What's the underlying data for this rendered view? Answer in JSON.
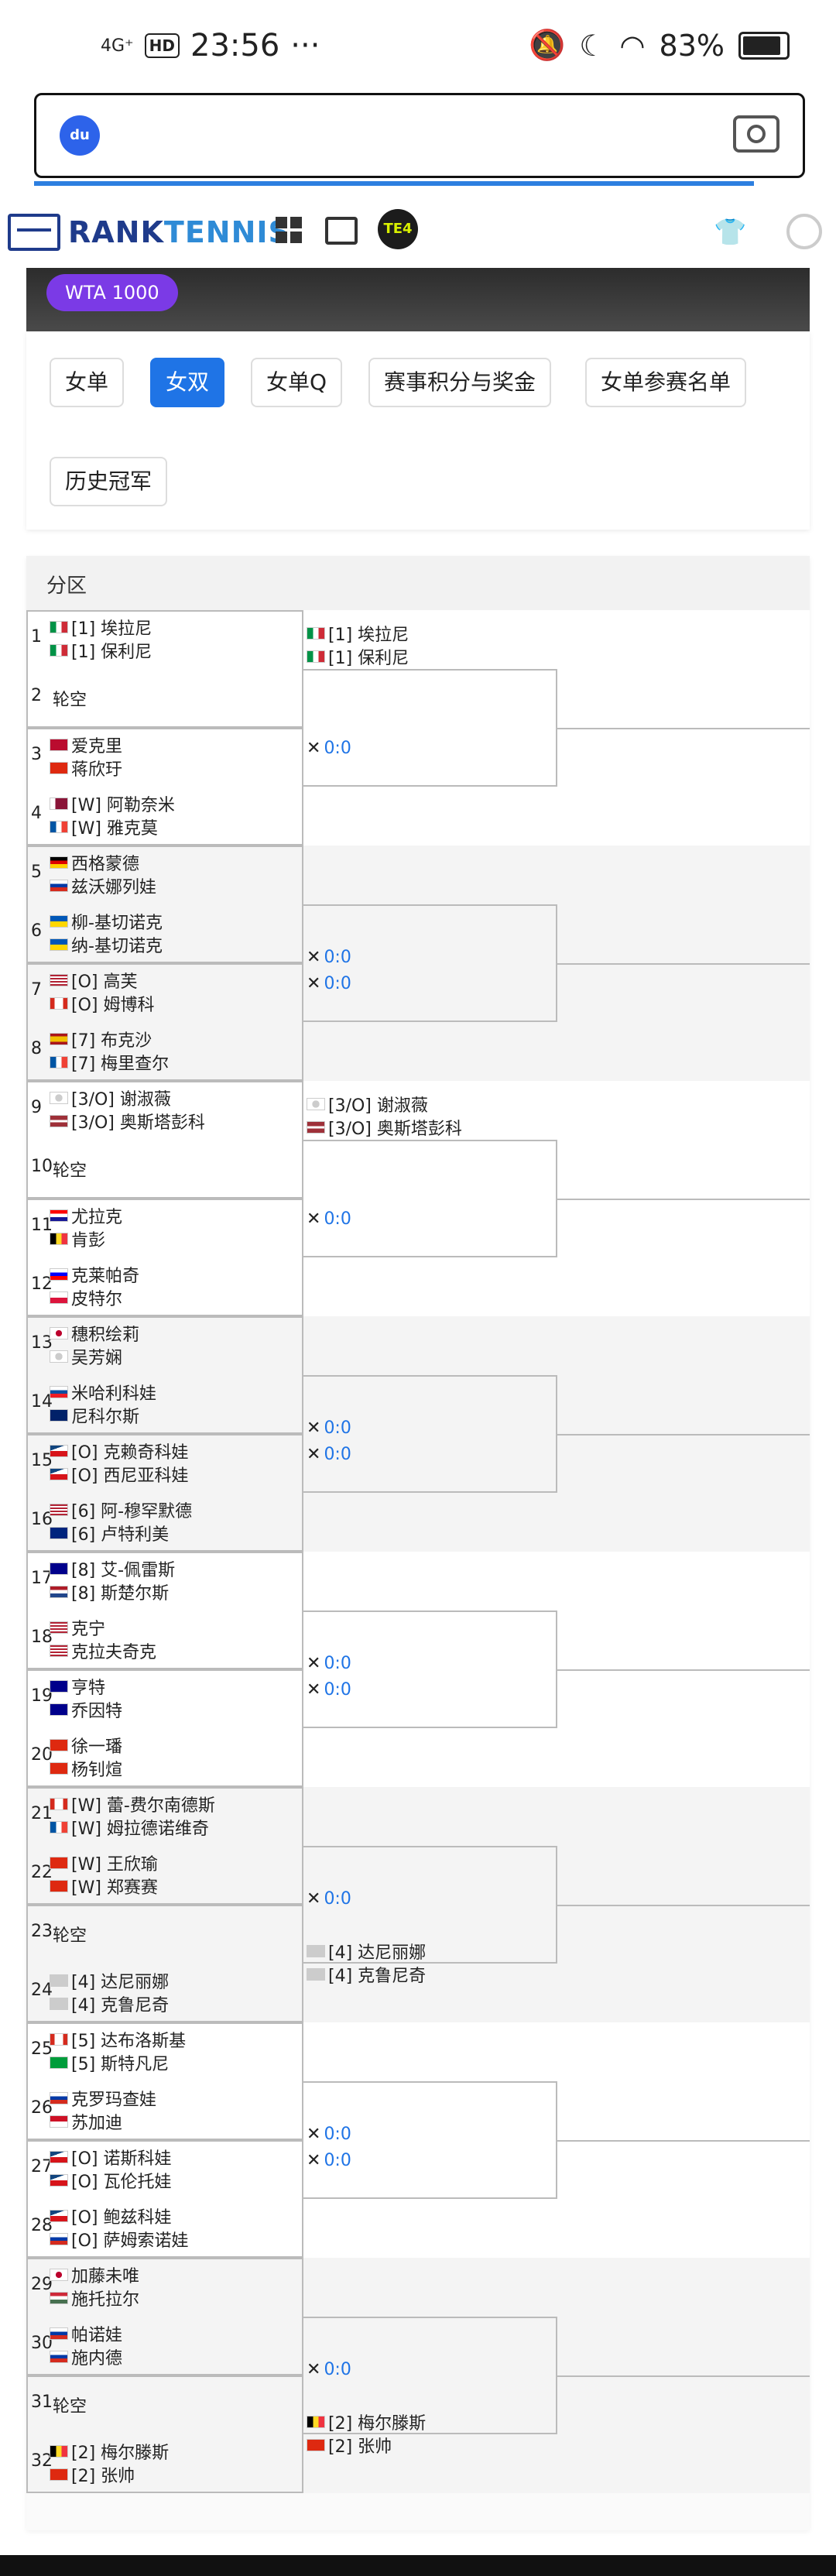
{
  "status_bar": {
    "network": "4G⁺",
    "hd": "HD",
    "time": "23:56",
    "more": "···",
    "battery": "83%"
  },
  "search": {
    "logo": "du"
  },
  "brand": {
    "name_a": "RANK",
    "name_b": "TENNIS",
    "te_badge": "TE4"
  },
  "event_badge": "WTA 1000",
  "tabs": [
    "女单",
    "女双",
    "女单Q",
    "赛事积分与奖金",
    "女单参赛名单",
    "历史冠军"
  ],
  "active_tab": 1,
  "zone_label": "分区",
  "slots": [
    {
      "num": "1",
      "type": "pair",
      "a": {
        "flag": "it",
        "name": "[1] 埃拉尼"
      },
      "b": {
        "flag": "it",
        "name": "[1] 保利尼"
      }
    },
    {
      "num": "2",
      "type": "bye",
      "label": "轮空"
    },
    {
      "num": "3",
      "type": "pair",
      "a": {
        "flag": "no",
        "name": "爱克里"
      },
      "b": {
        "flag": "cn",
        "name": "蒋欣玗"
      }
    },
    {
      "num": "4",
      "type": "pair",
      "a": {
        "flag": "qa",
        "name": "[W] 阿勒奈米"
      },
      "b": {
        "flag": "fr",
        "name": "[W] 雅克莫"
      }
    },
    {
      "num": "5",
      "type": "pair",
      "a": {
        "flag": "de",
        "name": "西格蒙德"
      },
      "b": {
        "flag": "ru",
        "name": "兹沃娜列娃"
      }
    },
    {
      "num": "6",
      "type": "pair",
      "a": {
        "flag": "ua",
        "name": "柳-基切诺克"
      },
      "b": {
        "flag": "ua",
        "name": "纳-基切诺克"
      }
    },
    {
      "num": "7",
      "type": "pair",
      "a": {
        "flag": "us",
        "name": "[O] 高芙"
      },
      "b": {
        "flag": "ca",
        "name": "[O] 姆博科"
      }
    },
    {
      "num": "8",
      "type": "pair",
      "a": {
        "flag": "es",
        "name": "[7] 布克沙"
      },
      "b": {
        "flag": "fr",
        "name": "[7] 梅里查尔"
      }
    },
    {
      "num": "9",
      "type": "pair",
      "a": {
        "flag": "tw",
        "name": "[3/O] 谢淑薇"
      },
      "b": {
        "flag": "lv",
        "name": "[3/O] 奥斯塔彭科"
      }
    },
    {
      "num": "10",
      "type": "bye",
      "label": "轮空"
    },
    {
      "num": "11",
      "type": "pair",
      "a": {
        "flag": "hr",
        "name": "尤拉克"
      },
      "b": {
        "flag": "be",
        "name": "肯彭"
      }
    },
    {
      "num": "12",
      "type": "pair",
      "a": {
        "flag": "si",
        "name": "克莱帕奇"
      },
      "b": {
        "flag": "pl",
        "name": "皮特尔"
      }
    },
    {
      "num": "13",
      "type": "pair",
      "a": {
        "flag": "jp",
        "name": "穗积绘莉"
      },
      "b": {
        "flag": "tw",
        "name": "吴芳娴"
      }
    },
    {
      "num": "14",
      "type": "pair",
      "a": {
        "flag": "sk",
        "name": "米哈利科娃"
      },
      "b": {
        "flag": "gb",
        "name": "尼科尔斯"
      }
    },
    {
      "num": "15",
      "type": "pair",
      "a": {
        "flag": "cz",
        "name": "[O] 克赖奇科娃"
      },
      "b": {
        "flag": "cz",
        "name": "[O] 西尼亚科娃"
      }
    },
    {
      "num": "16",
      "type": "pair",
      "a": {
        "flag": "us",
        "name": "[6] 阿-穆罕默德"
      },
      "b": {
        "flag": "nz",
        "name": "[6] 卢特利美"
      }
    },
    {
      "num": "17",
      "type": "pair",
      "a": {
        "flag": "au",
        "name": "[8] 艾-佩雷斯"
      },
      "b": {
        "flag": "nl",
        "name": "[8] 斯楚尔斯"
      }
    },
    {
      "num": "18",
      "type": "pair",
      "a": {
        "flag": "us",
        "name": "克宁"
      },
      "b": {
        "flag": "us",
        "name": "克拉夫奇克"
      }
    },
    {
      "num": "19",
      "type": "pair",
      "a": {
        "flag": "au",
        "name": "亨特"
      },
      "b": {
        "flag": "au",
        "name": "乔因特"
      }
    },
    {
      "num": "20",
      "type": "pair",
      "a": {
        "flag": "cn",
        "name": "徐一璠"
      },
      "b": {
        "flag": "cn",
        "name": "杨钊煊"
      }
    },
    {
      "num": "21",
      "type": "pair",
      "a": {
        "flag": "ca",
        "name": "[W] 蕾-费尔南德斯"
      },
      "b": {
        "flag": "fr",
        "name": "[W] 姆拉德诺维奇"
      }
    },
    {
      "num": "22",
      "type": "pair",
      "a": {
        "flag": "cn",
        "name": "[W] 王欣瑜"
      },
      "b": {
        "flag": "cn",
        "name": "[W] 郑赛赛"
      }
    },
    {
      "num": "23",
      "type": "bye",
      "label": "轮空"
    },
    {
      "num": "24",
      "type": "pair",
      "a": {
        "flag": "blank",
        "name": "[4] 达尼丽娜"
      },
      "b": {
        "flag": "blank",
        "name": "[4] 克鲁尼奇"
      }
    },
    {
      "num": "25",
      "type": "pair",
      "a": {
        "flag": "ca",
        "name": "[5] 达布洛斯基"
      },
      "b": {
        "flag": "br",
        "name": "[5] 斯特凡尼"
      }
    },
    {
      "num": "26",
      "type": "pair",
      "a": {
        "flag": "ru",
        "name": "克罗玛查娃"
      },
      "b": {
        "flag": "id",
        "name": "苏加迪"
      }
    },
    {
      "num": "27",
      "type": "pair",
      "a": {
        "flag": "cz",
        "name": "[O] 诺斯科娃"
      },
      "b": {
        "flag": "cz",
        "name": "[O] 瓦伦托娃"
      }
    },
    {
      "num": "28",
      "type": "pair",
      "a": {
        "flag": "cz",
        "name": "[O] 鲍兹科娃"
      },
      "b": {
        "flag": "ru",
        "name": "[O] 萨姆索诺娃"
      }
    },
    {
      "num": "29",
      "type": "pair",
      "a": {
        "flag": "jp",
        "name": "加藤未唯"
      },
      "b": {
        "flag": "hu",
        "name": "施托拉尔"
      }
    },
    {
      "num": "30",
      "type": "pair",
      "a": {
        "flag": "ru",
        "name": "帕诺娃"
      },
      "b": {
        "flag": "ru",
        "name": "施内德"
      }
    },
    {
      "num": "31",
      "type": "bye",
      "label": "轮空"
    },
    {
      "num": "32",
      "type": "pair",
      "a": {
        "flag": "be",
        "name": "[2] 梅尔滕斯"
      },
      "b": {
        "flag": "cn",
        "name": "[2] 张帅"
      }
    }
  ],
  "round2": [
    {
      "type": "pair",
      "a": {
        "flag": "it",
        "name": "[1] 埃拉尼"
      },
      "b": {
        "flag": "it",
        "name": "[1] 保利尼"
      }
    },
    {
      "type": "score",
      "score": "0:0"
    },
    {
      "type": "score",
      "score": "0:0"
    },
    {
      "type": "score",
      "score": "0:0"
    },
    {
      "type": "pair",
      "a": {
        "flag": "tw",
        "name": "[3/O] 谢淑薇"
      },
      "b": {
        "flag": "lv",
        "name": "[3/O] 奥斯塔彭科"
      }
    },
    {
      "type": "score",
      "score": "0:0"
    },
    {
      "type": "score",
      "score": "0:0"
    },
    {
      "type": "score",
      "score": "0:0"
    },
    {
      "type": "score",
      "score": "0:0"
    },
    {
      "type": "score",
      "score": "0:0"
    },
    {
      "type": "score",
      "score": "0:0"
    },
    {
      "type": "pair",
      "a": {
        "flag": "blank",
        "name": "[4] 达尼丽娜"
      },
      "b": {
        "flag": "blank",
        "name": "[4] 克鲁尼奇"
      }
    },
    {
      "type": "score",
      "score": "0:0"
    },
    {
      "type": "score",
      "score": "0:0"
    },
    {
      "type": "score",
      "score": "0:0"
    },
    {
      "type": "pair",
      "a": {
        "flag": "be",
        "name": "[2] 梅尔滕斯"
      },
      "b": {
        "flag": "cn",
        "name": "[2] 张帅"
      }
    }
  ]
}
